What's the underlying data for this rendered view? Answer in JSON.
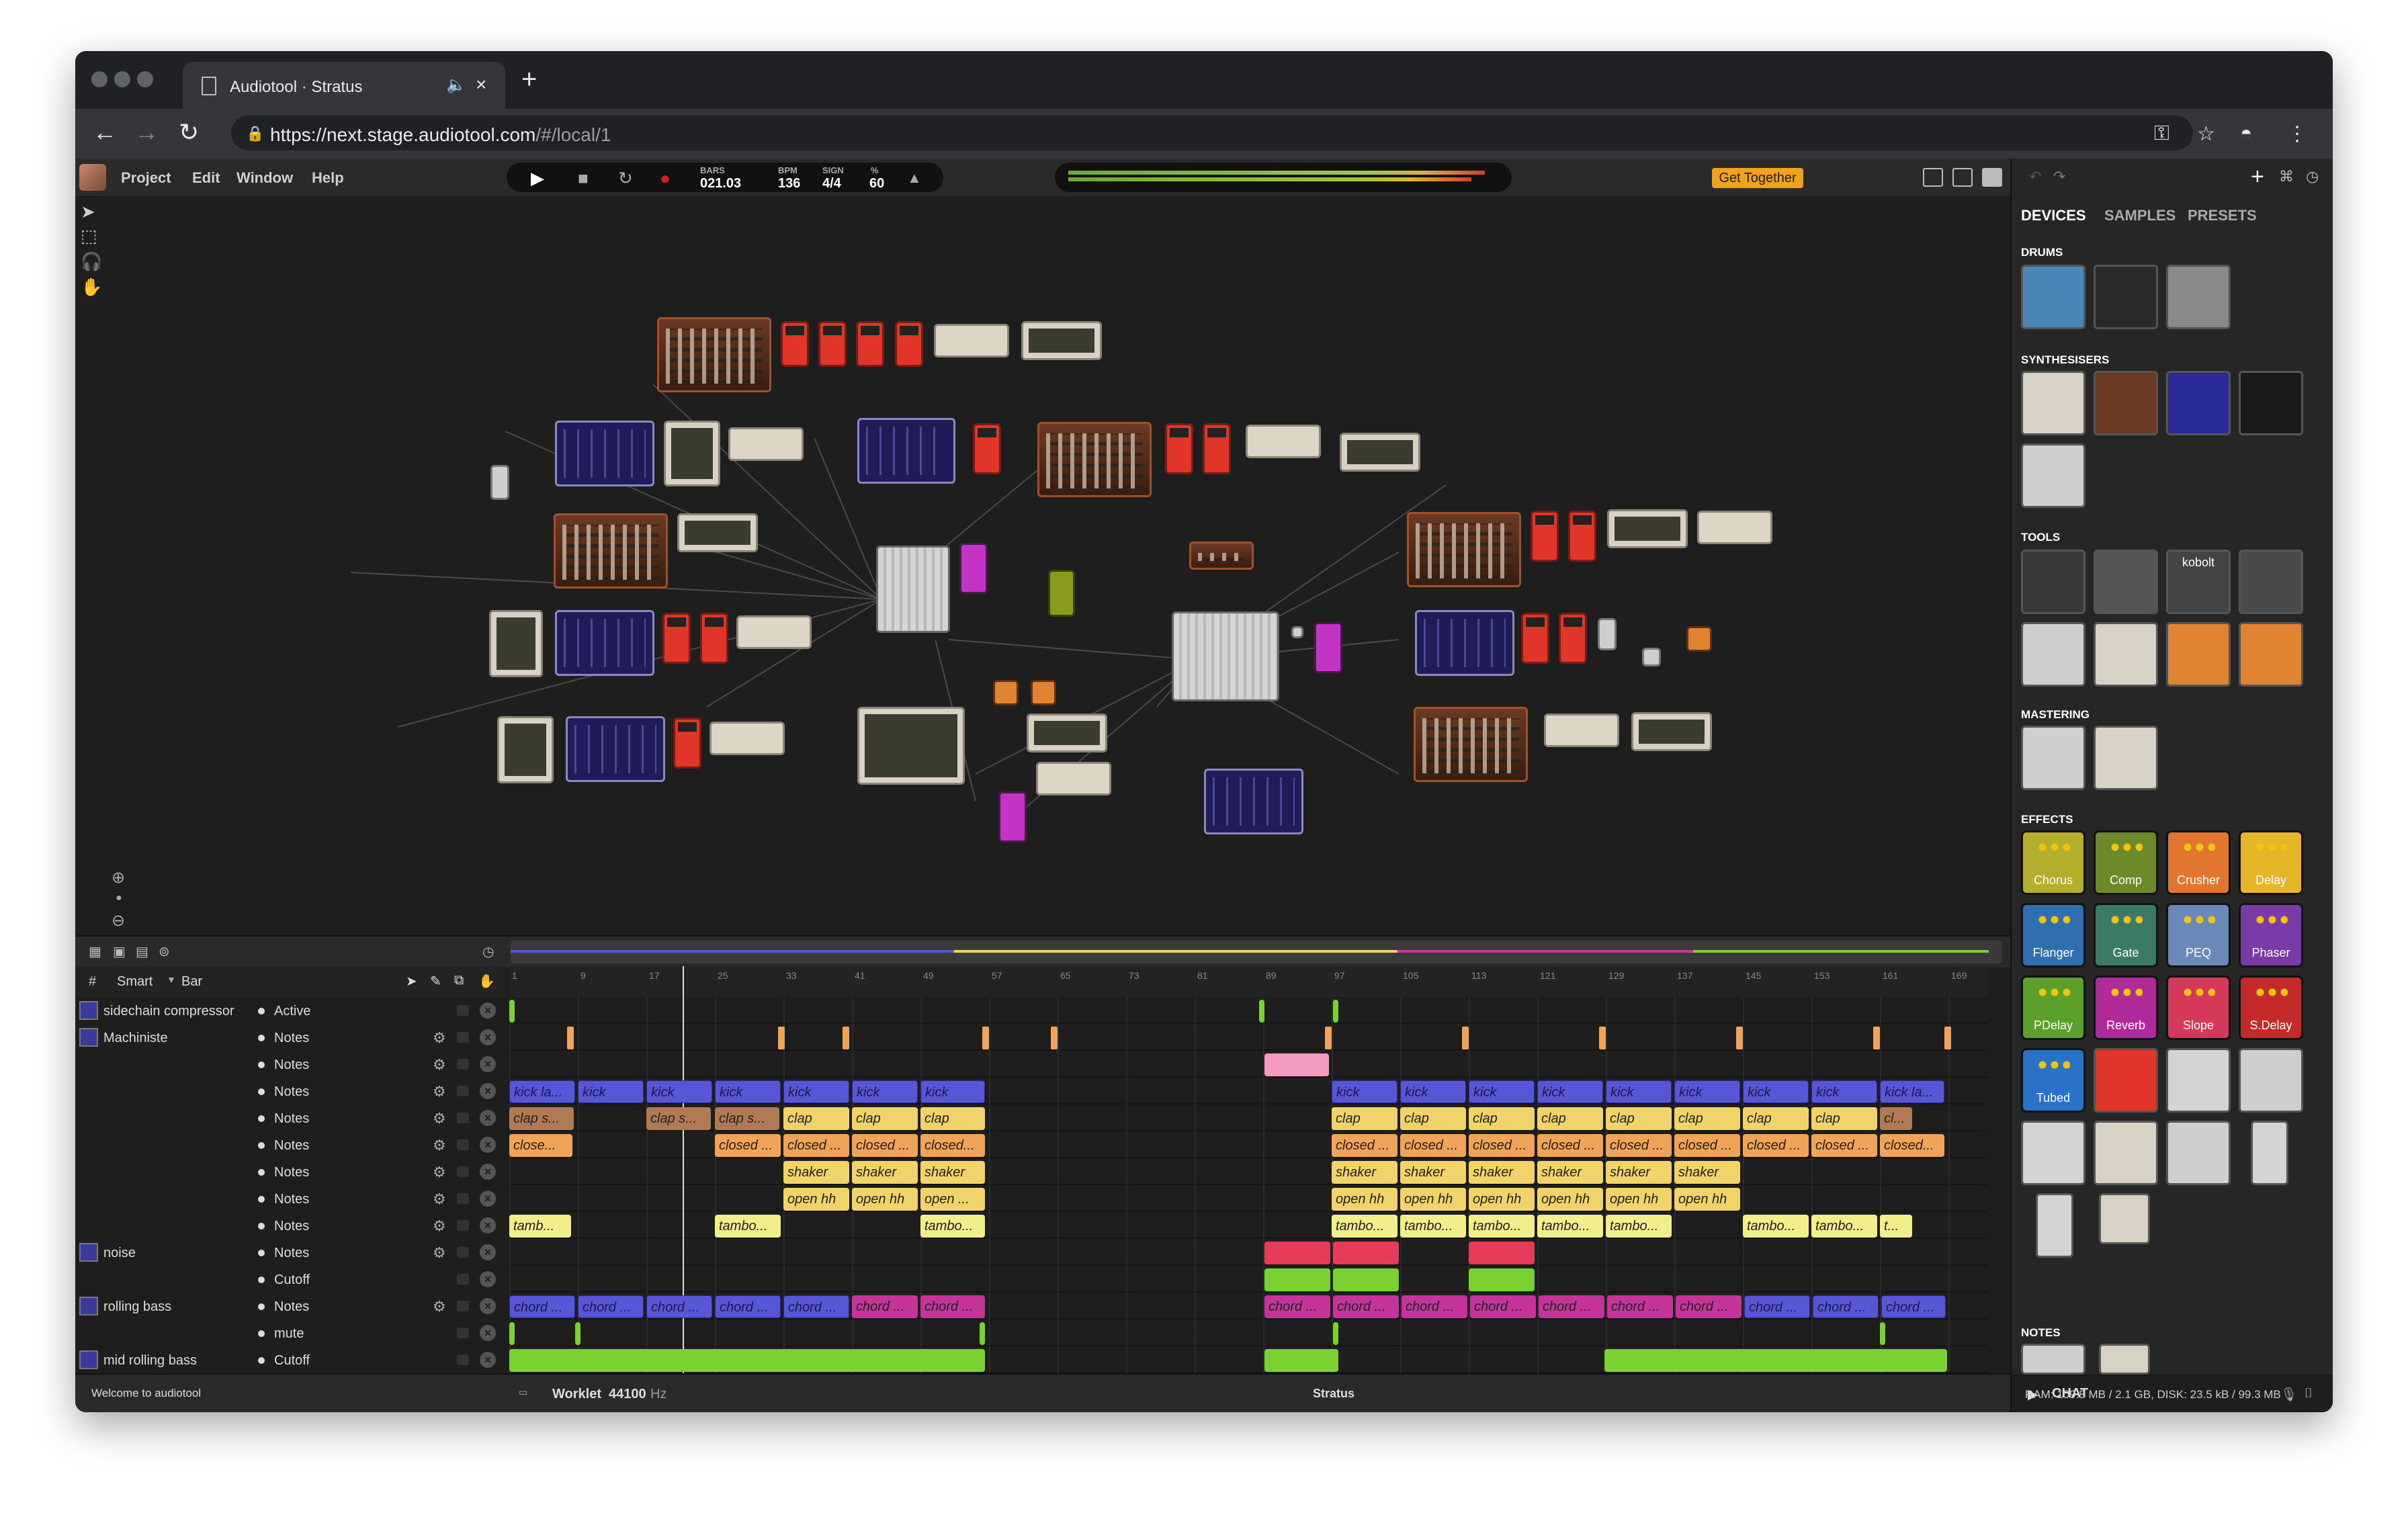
{
  "browser": {
    "tab_title": "Audiotool · Stratus",
    "url_host": "https://next.stage.audiotool.com",
    "url_path": "/#/local/1"
  },
  "menu": {
    "items": [
      "Project",
      "Edit",
      "Window",
      "Help"
    ]
  },
  "transport": {
    "bars_label": "BARS",
    "bars_value": "021.03",
    "bpm_label": "BPM",
    "bpm_value": "136",
    "sign_label": "SIGN",
    "sign_value": "4/4",
    "pct_label": "%",
    "pct_value": "60"
  },
  "get_together": "Get Together",
  "side": {
    "tabs": [
      "DEVICES",
      "SAMPLES",
      "PRESETS"
    ],
    "categories": {
      "drums": "DRUMS",
      "synths": "SYNTHESISERS",
      "tools": "TOOLS",
      "mastering": "MASTERING",
      "effects": "EFFECTS",
      "notes": "NOTES"
    },
    "effects": [
      "Chorus",
      "Comp",
      "Crusher",
      "Delay",
      "Flanger",
      "Gate",
      "PEQ",
      "Phaser",
      "PDelay",
      "Reverb",
      "Slope",
      "S.Delay",
      "Tubed"
    ],
    "tool_label": "kobolt",
    "chat": "CHAT",
    "stats": "RAM: 109.8 MB / 2.1 GB, DISK: 23.5 kB / 99.3 MB",
    "colors": {
      "chorus": "#b5ad2c",
      "comp": "#6c8a2a",
      "crusher": "#e2762e",
      "delay": "#e6b52a",
      "flanger": "#2e6fb0",
      "gate": "#3a7a66",
      "peq": "#6a88b8",
      "phaser": "#7a3aa8",
      "pdelay": "#5aa02a",
      "reverb": "#b02a9a",
      "slope": "#d6385a",
      "sdelay": "#c52a2a",
      "tubed": "#2a72c8"
    }
  },
  "sequencer": {
    "snap": "Smart",
    "unit": "Bar",
    "ruler": [
      "1",
      "9",
      "17",
      "25",
      "33",
      "41",
      "49",
      "57",
      "65",
      "73",
      "81",
      "89",
      "97",
      "105",
      "113",
      "121",
      "129",
      "137",
      "145",
      "153",
      "161",
      "169"
    ],
    "tracks": [
      {
        "name": "sidechain compressor",
        "param": "Active"
      },
      {
        "name": "Machiniste",
        "param": "Notes"
      },
      {
        "name": "",
        "param": "Notes"
      },
      {
        "name": "",
        "param": "Notes"
      },
      {
        "name": "",
        "param": "Notes"
      },
      {
        "name": "",
        "param": "Notes"
      },
      {
        "name": "",
        "param": "Notes"
      },
      {
        "name": "",
        "param": "Notes"
      },
      {
        "name": "",
        "param": "Notes"
      },
      {
        "name": "noise",
        "param": "Notes"
      },
      {
        "name": "",
        "param": "Cutoff"
      },
      {
        "name": "rolling bass",
        "param": "Notes"
      },
      {
        "name": "",
        "param": "mute"
      },
      {
        "name": "mid rolling bass",
        "param": "Cutoff"
      }
    ],
    "clip_labels": {
      "kick1": "kick la...",
      "kick": "kick",
      "kick_last": "kick la...",
      "clap1": "clap s...",
      "clap2": "clap s...",
      "clap": "clap",
      "clap_last": "cl...",
      "close1": "close...",
      "closed": "closed ...",
      "closed_short": "closed...",
      "shaker": "shaker",
      "openhh": "open hh",
      "open_short": "open ...",
      "tamb1": "tamb...",
      "tambo": "tambo...",
      "tamb_t": "t...",
      "chord": "chord ..."
    }
  },
  "status": {
    "left": "Welcome to audiotool",
    "engine": "Worklet",
    "rate": "44100",
    "rate_unit": "Hz",
    "project": "Stratus"
  }
}
